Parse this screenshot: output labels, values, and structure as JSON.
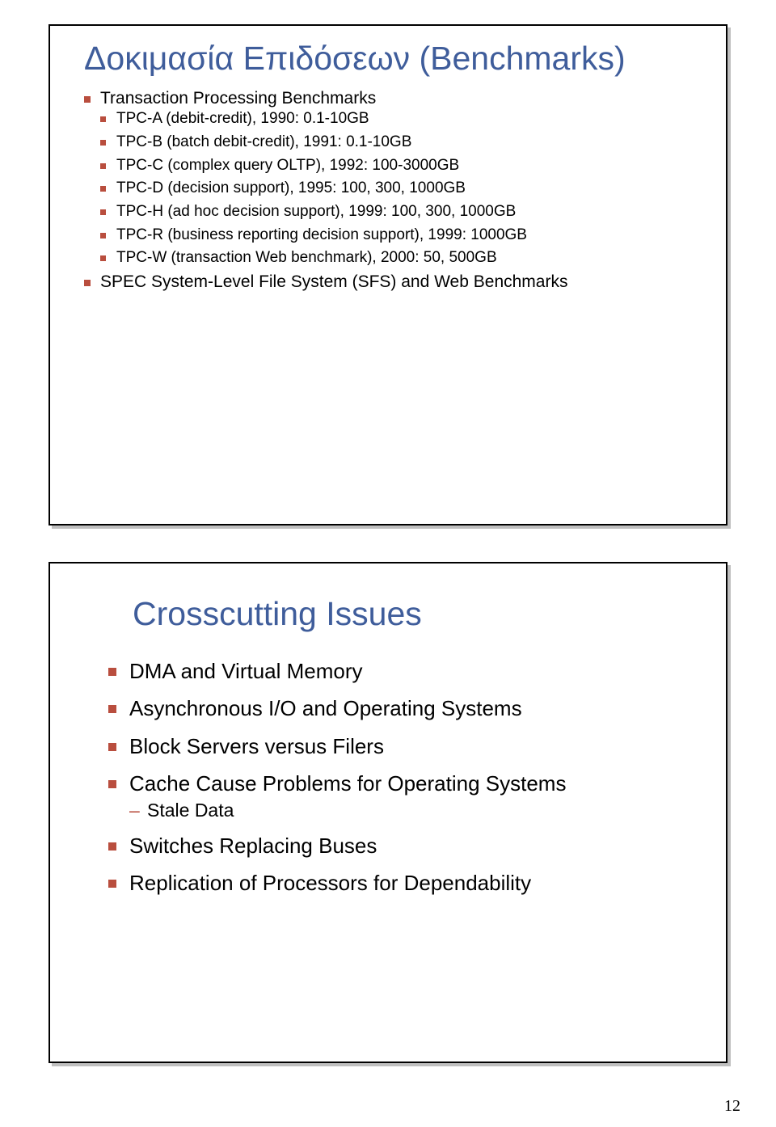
{
  "slide1": {
    "title": "Δοκιμασία Επιδόσεων (Benchmarks)",
    "items": [
      {
        "text": "Transaction Processing Benchmarks",
        "sub": [
          "TPC-A (debit-credit), 1990: 0.1-10GB",
          "TPC-B (batch debit-credit), 1991: 0.1-10GB",
          "TPC-C (complex query OLTP), 1992: 100-3000GB",
          "TPC-D (decision support), 1995: 100, 300, 1000GB",
          "TPC-H (ad hoc decision support), 1999: 100, 300, 1000GB",
          "TPC-R (business reporting decision support), 1999: 1000GB",
          "TPC-W (transaction Web benchmark), 2000: 50, 500GB"
        ]
      },
      {
        "text": "SPEC System-Level File System (SFS) and Web Benchmarks"
      }
    ]
  },
  "slide2": {
    "title": "Crosscutting Issues",
    "items": [
      {
        "text": "DMA and Virtual Memory"
      },
      {
        "text": "Asynchronous I/O and Operating Systems"
      },
      {
        "text": "Block Servers versus Filers"
      },
      {
        "text": "Cache Cause Problems for Operating Systems",
        "sub": [
          "Stale Data"
        ]
      },
      {
        "text": "Switches Replacing Buses"
      },
      {
        "text": "Replication of Processors for Dependability"
      }
    ]
  },
  "page_number": "12"
}
